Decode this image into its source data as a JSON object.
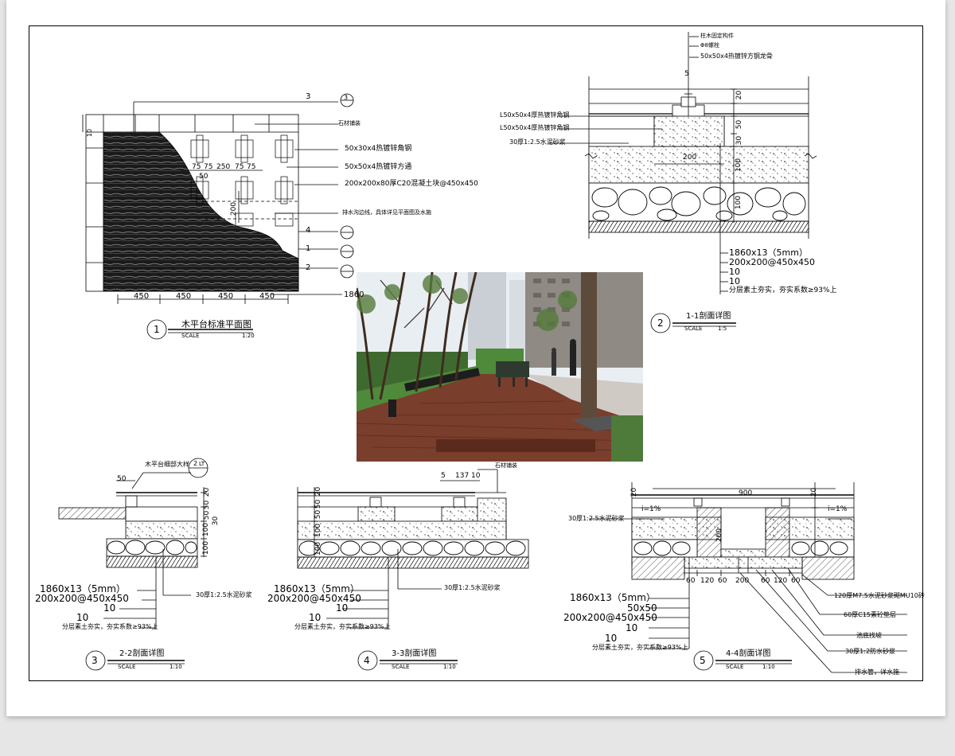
{
  "colors": {
    "paper": "#ffffff",
    "line": "#000000",
    "deck": "#7a3e2c",
    "grass": "#4e8a3a",
    "sky": "#e9eef2"
  },
  "plan": {
    "ref_3": "3",
    "ref_4": "4",
    "ref_1": "1",
    "ref_2": "2",
    "sheet_ref": "1",
    "lbl_stone": "石材铺装",
    "lbl_angle": "50x30x4热镀锌角钢",
    "lbl_tube": "50x50x4热镀锌方通",
    "lbl_block": "200x200x80厚C20混凝土块@450x450",
    "lbl_drain": "排水沟边线，具体详见平面图及水施",
    "dim_75a": "75",
    "dim_75b": "75",
    "dim_250": "250",
    "dim_75c": "75",
    "dim_75d": "75",
    "dim_50": "50",
    "dim_200": "200",
    "dim_10": "10",
    "dims_bottom": [
      "450",
      "450",
      "450",
      "450"
    ],
    "lbl_1860": "1860",
    "title_num": "1",
    "title": "木平台标准平面图",
    "scale_label": "SCALE",
    "scale": "1:20"
  },
  "s11": {
    "lbl_fix": "柱木固定构件",
    "lbl_bolt": "Φ8螺栓",
    "lbl_tube": "50x50x4热镀锌方钢龙骨",
    "lbl_angle1": "L50x50x4厚热镀锌角钢",
    "lbl_angle2": "L50x50x4厚热镀锌角钢",
    "lbl_mortar": "30厚1:2.5水泥砂浆",
    "dim_5": "5",
    "dim_20": "20",
    "dim_50": "50",
    "dim_30": "30",
    "dim_100a": "100",
    "dim_100b": "100",
    "dim_200": "200",
    "layer1": "1860x13",
    "layer1_tail": "（5mm）",
    "layer2": "200x200",
    "layer2_tail": "@450x450",
    "layer3": "10",
    "layer4": "10",
    "layer5": "分层素土夯实，夯实系数≥93%上",
    "title_num": "2",
    "title": "1-1剖面详图",
    "scale_label": "SCALE",
    "scale": "1:5"
  },
  "s22": {
    "ref_tag": "2",
    "ref_lt": "LT",
    "lbl_detail": "木平台细部大样",
    "dim_50": "50",
    "dim_20": "20",
    "dim_50b": "50",
    "dim_50c": "50",
    "dim_30": "30",
    "dim_100a": "100",
    "dim_100b": "100",
    "lbl_mortar": "30厚1:2.5水泥砂浆",
    "layer1": "1860x13",
    "layer1_tail": "（5mm）",
    "layer2": "200x200",
    "layer2_tail": "@450x450",
    "layer3": "10",
    "layer4": "10",
    "layer5": "分层素土夯实，夯实系数≥93%上",
    "title_num": "3",
    "title": "2-2剖面详图",
    "scale_label": "SCALE",
    "scale": "1:10"
  },
  "s33": {
    "lbl_stone": "石材铺装",
    "dim_5": "5",
    "dim_137": "137",
    "dim_10": "10",
    "dim_20": "20",
    "dim_50a": "50",
    "dim_50b": "50",
    "dim_100a": "100",
    "dim_100b": "100",
    "lbl_mortar": "30厚1:2.5水泥砂浆",
    "layer1": "1860x13",
    "layer1_tail": "（5mm）",
    "layer2": "200x200",
    "layer2_tail": "@450x450",
    "layer3": "10",
    "layer4": "10",
    "layer5": "分层素土夯实，夯实系数≥93%上",
    "title_num": "4",
    "title": "3-3剖面详图",
    "scale_label": "SCALE",
    "scale": "1:10"
  },
  "s44": {
    "dim_top": "900",
    "slope_l": "i=1%",
    "slope_r": "i=1%",
    "dim_20a": "20",
    "dim_20b": "20",
    "dim_200": "200",
    "lbl_mortar": "30厚1:2.5水泥砂浆",
    "dims_bottom": [
      "60",
      "120",
      "60",
      "200",
      "60",
      "120",
      "60"
    ],
    "lbl_wall": "120厚M7.5水泥砂浆砌MU10砖",
    "lbl_c15": "60厚C15素砼垫层",
    "lbl_slope": "池底找坡",
    "lbl_mortar2": "30厚1:2防水砂浆",
    "lbl_drain": "排水管，详水施",
    "layer1": "1860x13",
    "layer1_tail": "（5mm）",
    "layer1b": "50x50",
    "layer2": "200x200",
    "layer2_tail": "@450x450",
    "layer3": "10",
    "layer4": "10",
    "layer5": "分层素土夯实，夯实系数≥93%上",
    "title_num": "5",
    "title": "4-4剖面详图",
    "scale_label": "SCALE",
    "scale": "1:10"
  }
}
